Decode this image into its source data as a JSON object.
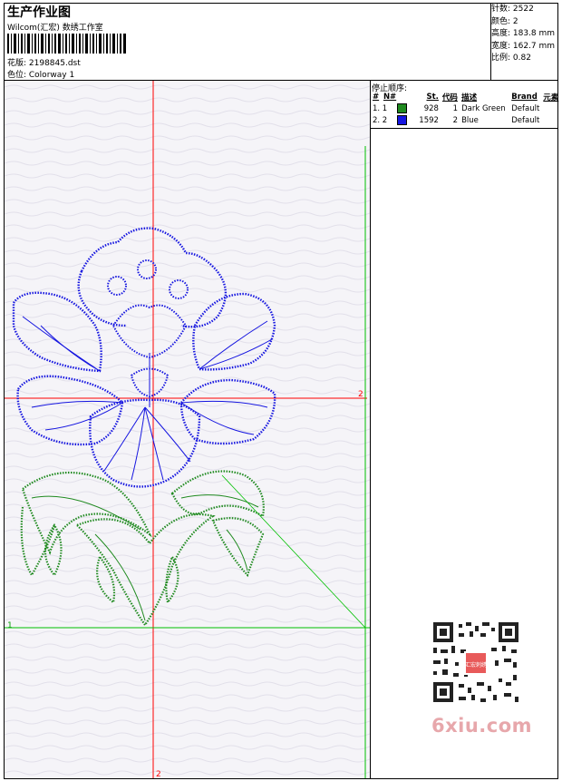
{
  "header": {
    "title": "生产作业图",
    "subtitle": "Wilcom(汇宏) 数绣工作室",
    "design_label": "花版: 2198845.dst",
    "colorway_label": "色位: Colorway 1"
  },
  "stats": {
    "stitches": "针数: 2522",
    "colors": "颜色: 2",
    "height": "高度: 183.8 mm",
    "width": "宽度: 162.7 mm",
    "scale": "比例: 0.82"
  },
  "stop_sequence": {
    "title": "停止顺序:",
    "headers": [
      "#",
      "N#",
      "St.",
      "代码",
      "描述",
      "Brand",
      "元素"
    ],
    "rows": [
      {
        "idx": "1. 1",
        "color": "#1f8a1f",
        "st": "928",
        "code": "1",
        "desc": "Dark Green",
        "brand": "Default"
      },
      {
        "idx": "2. 2",
        "color": "#1515e0",
        "st": "1592",
        "code": "2",
        "desc": "Blue",
        "brand": "Default"
      }
    ]
  },
  "canvas": {
    "axis_1_top": "1",
    "axis_2_right": "2",
    "axis_2_bottom": "2"
  },
  "watermark": {
    "text": "6xiu.com",
    "stamp": "汇宏刺绣"
  },
  "colors": {
    "green_thread": "#1f8a1f",
    "blue_thread": "#1515e0",
    "red_axis": "#ff0000",
    "green_axis": "#00c000"
  }
}
